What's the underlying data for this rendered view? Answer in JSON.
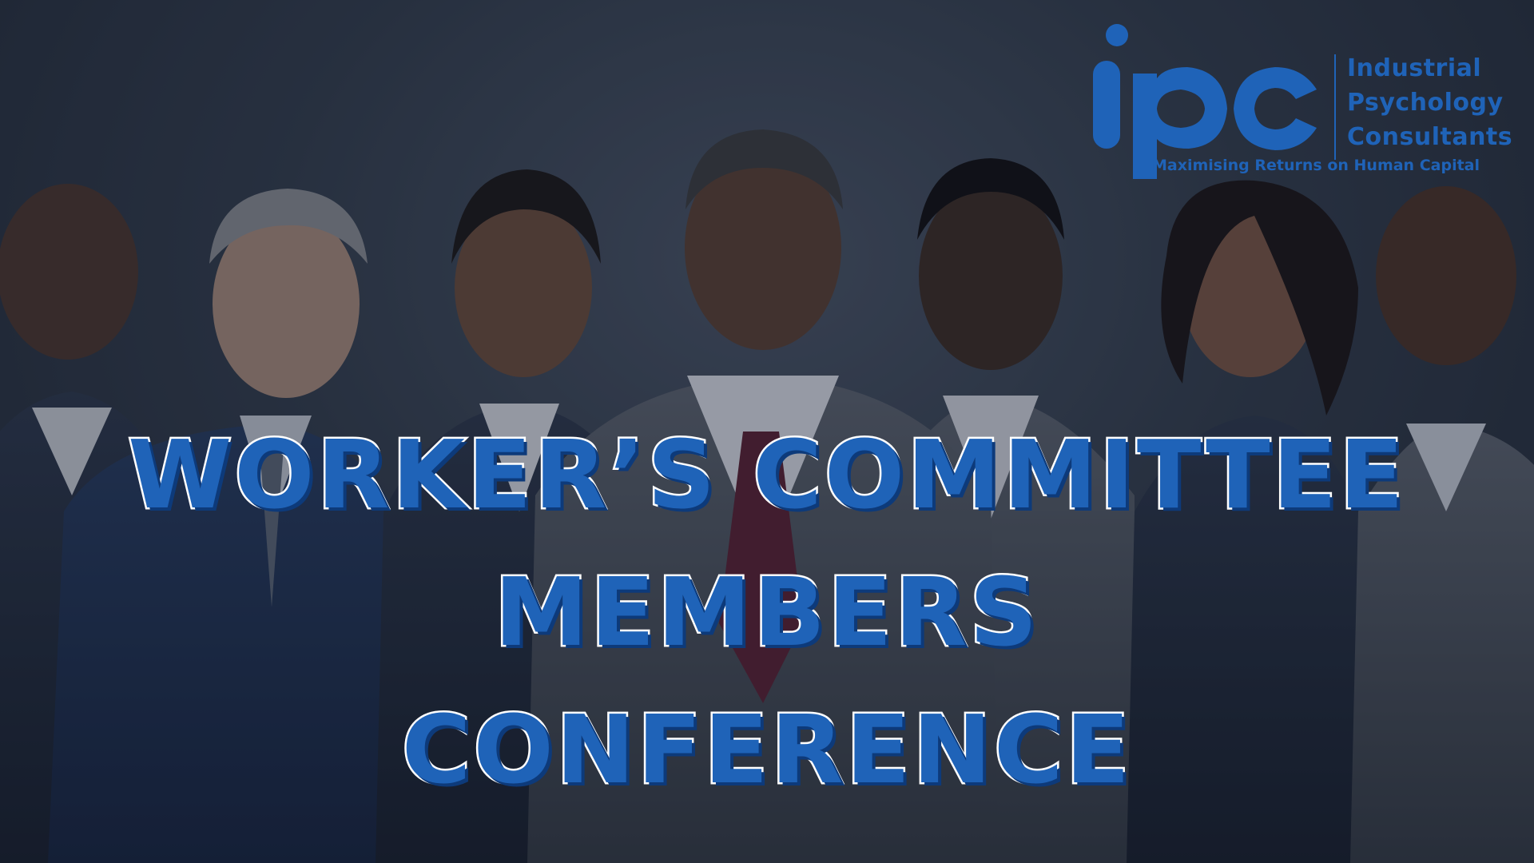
{
  "banner": {
    "title_lines": [
      "WORKER’S COMMITTEE",
      "MEMBERS",
      "CONFERENCE"
    ]
  },
  "logo": {
    "mark": "ipc",
    "words": [
      "Industrial",
      "Psychology",
      "Consultants"
    ],
    "tagline": "Maximising Returns on Human Capital",
    "color": "#1f63b8"
  },
  "photo": {
    "icon": "group-of-business-people"
  }
}
